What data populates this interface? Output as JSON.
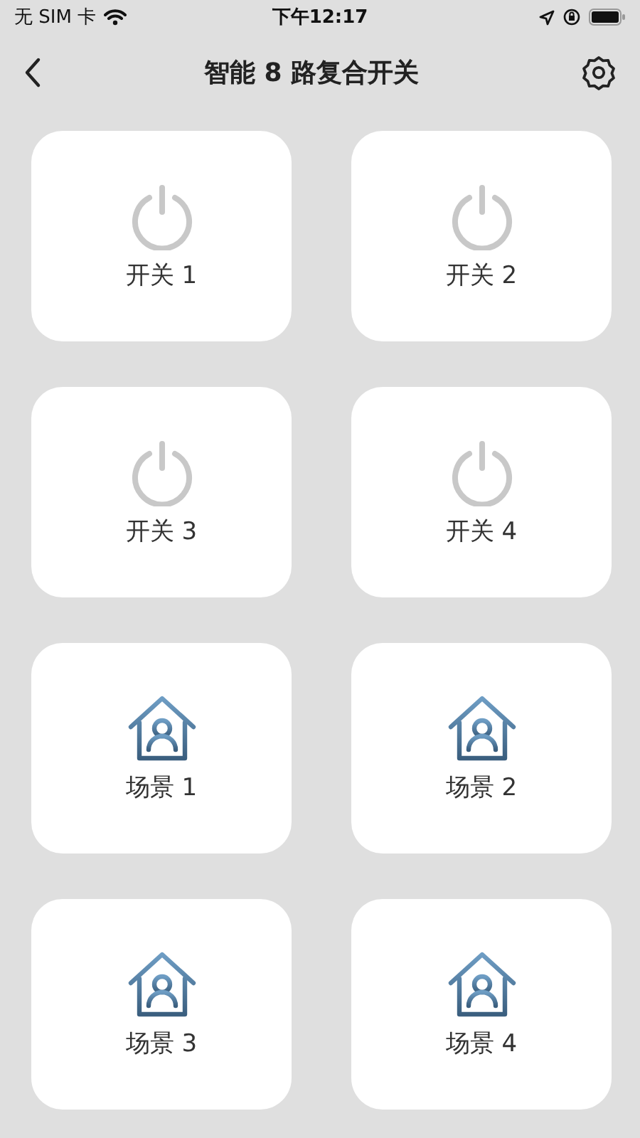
{
  "status_bar": {
    "carrier": "无 SIM 卡",
    "time": "下午12:17"
  },
  "nav": {
    "title": "智能 8 路复合开关"
  },
  "tiles": [
    {
      "kind": "switch",
      "label": "开关 1",
      "on": false
    },
    {
      "kind": "switch",
      "label": "开关 2",
      "on": false
    },
    {
      "kind": "switch",
      "label": "开关 3",
      "on": false
    },
    {
      "kind": "switch",
      "label": "开关 4",
      "on": false
    },
    {
      "kind": "scene",
      "label": "场景 1"
    },
    {
      "kind": "scene",
      "label": "场景 2"
    },
    {
      "kind": "scene",
      "label": "场景 3"
    },
    {
      "kind": "scene",
      "label": "场景 4"
    }
  ]
}
